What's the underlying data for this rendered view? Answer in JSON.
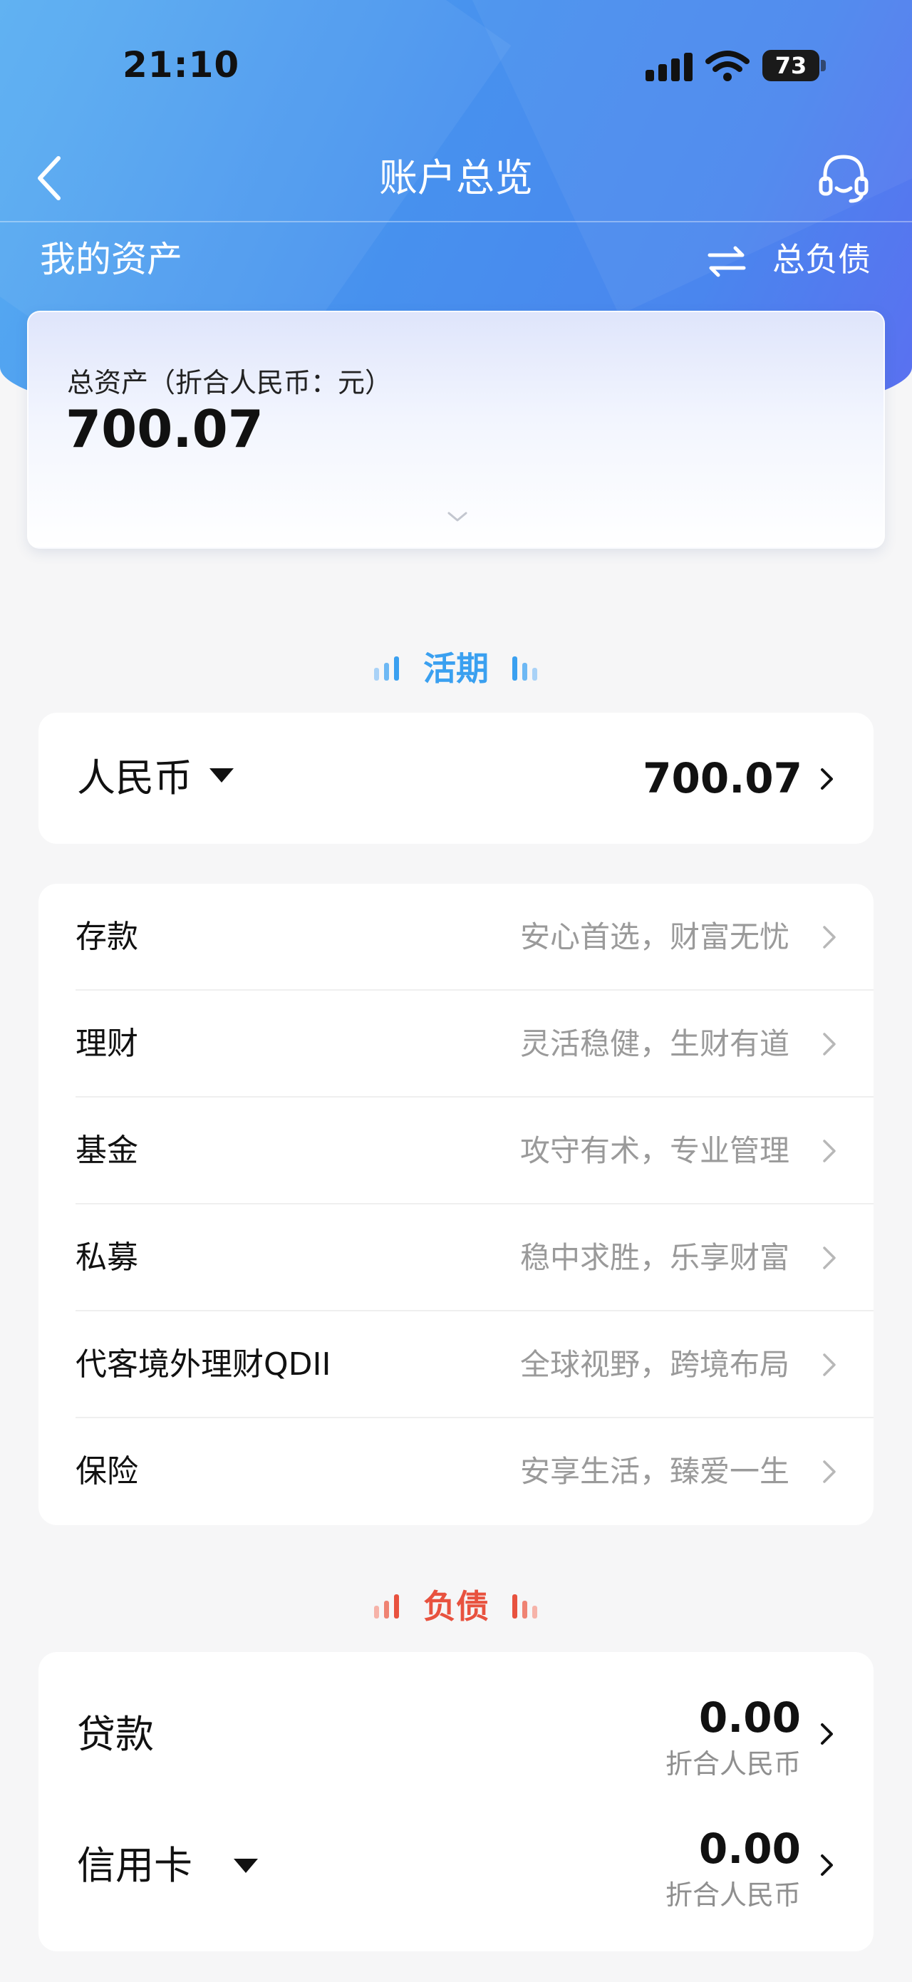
{
  "status_bar": {
    "time": "21:10",
    "battery": "73"
  },
  "nav": {
    "title": "账户总览"
  },
  "assets_header": {
    "title": "我的资产",
    "debt_link": "总负债"
  },
  "total_card": {
    "label": "总资产（折合人民币：元）",
    "value": "700.07"
  },
  "demand_section": {
    "title": "活期",
    "color": "#3aa0f0"
  },
  "currency_card": {
    "currency": "人民币",
    "value": "700.07"
  },
  "products": [
    {
      "name": "存款",
      "desc": "安心首选，财富无忧"
    },
    {
      "name": "理财",
      "desc": "灵活稳健，生财有道"
    },
    {
      "name": "基金",
      "desc": "攻守有术，专业管理"
    },
    {
      "name": "私募",
      "desc": "稳中求胜，乐享财富"
    },
    {
      "name": "代客境外理财QDII",
      "desc": "全球视野，跨境布局"
    },
    {
      "name": "保险",
      "desc": "安享生活，臻爱一生"
    }
  ],
  "liability_section": {
    "title": "负债",
    "color": "#e8523f"
  },
  "liabilities": [
    {
      "name": "贷款",
      "value": "0.00",
      "sub": "折合人民币"
    },
    {
      "name": "信用卡",
      "value": "0.00",
      "sub": "折合人民币"
    }
  ]
}
